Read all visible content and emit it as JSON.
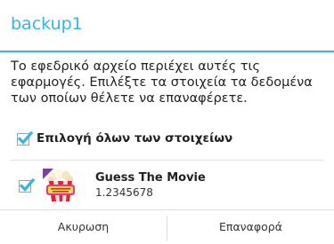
{
  "dialog": {
    "title": "backup1",
    "message_lines": [
      "Το εφεδρικό αρχείο περιέχει αυτές τις",
      "εφαρμογές. Επιλέξτε τα στοιχεία τα δεδομένα",
      "των οποίων θέλετε να επαναφέρετε."
    ],
    "select_all": {
      "label": "Επιλογή όλων των στοιχείων",
      "checked": true
    },
    "apps": [
      {
        "name": "Guess The Movie",
        "version": "1.2345678",
        "checked": true,
        "icon": "popcorn-movie-icon"
      }
    ],
    "buttons": {
      "cancel": "Ακυρωση",
      "restore": "Επαναφορά"
    }
  },
  "colors": {
    "accent": "#33b5e5",
    "checkmark": "#33b5e5"
  }
}
